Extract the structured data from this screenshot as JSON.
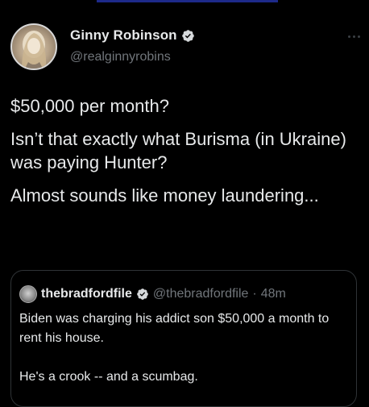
{
  "colors": {
    "background": "#000000",
    "text_primary": "#e7e9ea",
    "text_secondary": "#71767b",
    "verified_badge": "#d6d9db",
    "border": "#2f3336"
  },
  "tweet": {
    "author": {
      "display_name": "Ginny Robinson",
      "handle": "@realginnyrobins",
      "verified_icon": "verified-badge-icon"
    },
    "more_icon": "more-options-icon",
    "paragraphs": [
      "$50,000 per month?",
      "Isn’t that exactly what Burisma (in Ukraine) was paying Hunter?",
      "Almost sounds like money laundering..."
    ]
  },
  "quote": {
    "author": {
      "display_name": "thebradfordfile",
      "handle": "@thebradfordfile",
      "separator": "·",
      "time": "48m",
      "verified_icon": "verified-badge-icon"
    },
    "paragraphs": [
      "Biden was charging his addict son $50,000 a month to rent his house.",
      "He's a crook -- and a scumbag."
    ]
  }
}
